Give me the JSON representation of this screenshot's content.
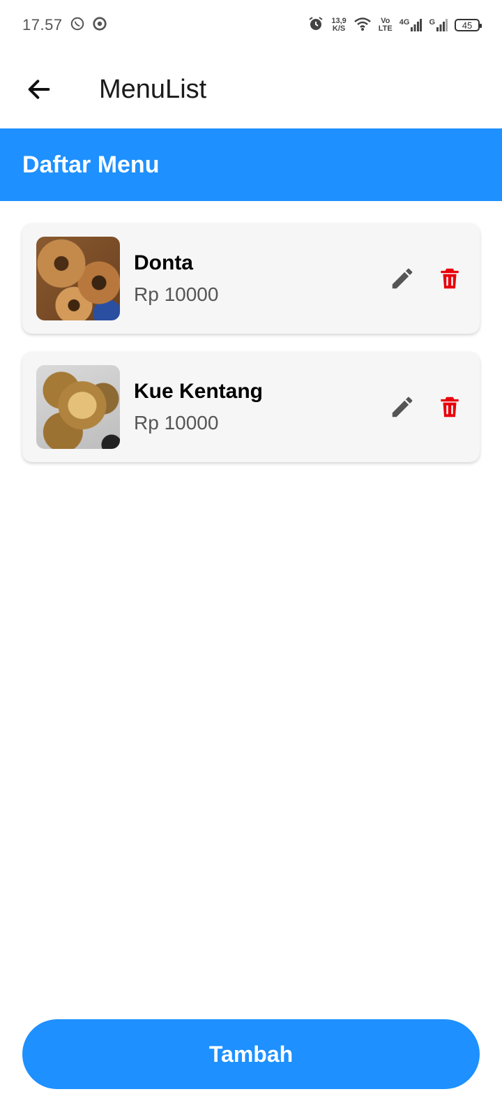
{
  "status_bar": {
    "time": "17.57",
    "speed_value": "13,9",
    "speed_unit": "K/S",
    "volte_top": "Vo",
    "volte_bottom": "LTE",
    "network_4g": "4G",
    "network_g": "G",
    "battery": "45"
  },
  "app_bar": {
    "title": "MenuList",
    "back_icon": "arrow-left-icon"
  },
  "section": {
    "title": "Daftar Menu",
    "color": "#1e90ff"
  },
  "menu_items": [
    {
      "name": "Donta",
      "price": "Rp 10000",
      "image_icon": "donut-photo"
    },
    {
      "name": "Kue Kentang",
      "price": "Rp 10000",
      "image_icon": "potato-cake-photo"
    }
  ],
  "actions": {
    "edit_icon": "pencil-icon",
    "delete_icon": "trash-icon",
    "edit_color": "#555555",
    "delete_color": "#e8000b"
  },
  "footer": {
    "add_label": "Tambah"
  }
}
